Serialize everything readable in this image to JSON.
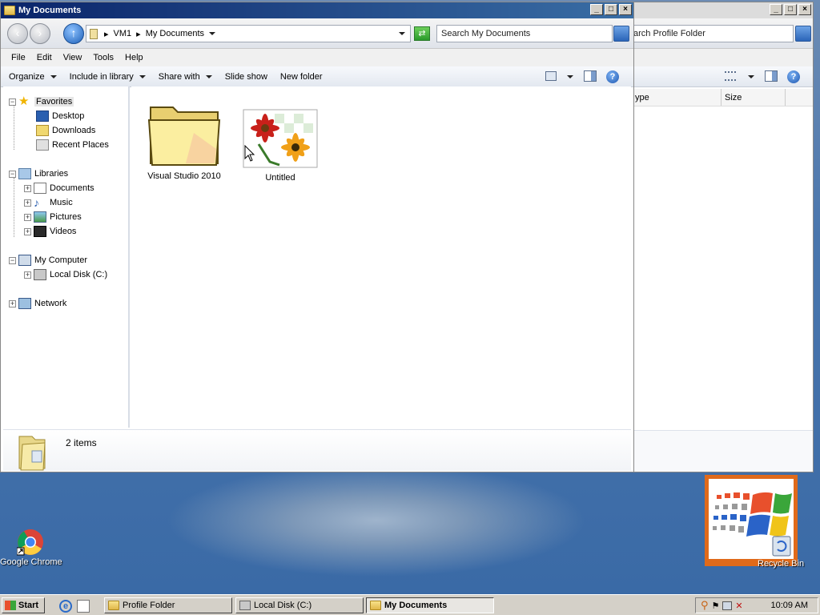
{
  "desktop": {
    "icons": [
      {
        "label": "Google Chrome"
      },
      {
        "label": "Recycle Bin"
      }
    ]
  },
  "bg_window": {
    "search_placeholder": "arch Profile Folder",
    "columns": [
      "ype",
      "Size"
    ]
  },
  "main_window": {
    "title": "My Documents",
    "breadcrumb": [
      "VM1",
      "My Documents"
    ],
    "search_placeholder": "Search My Documents",
    "menu": [
      "File",
      "Edit",
      "View",
      "Tools",
      "Help"
    ],
    "commands": [
      "Organize",
      "Include in library",
      "Share with",
      "Slide show",
      "New folder"
    ],
    "nav": {
      "favorites": "Favorites",
      "desktop": "Desktop",
      "downloads": "Downloads",
      "recent": "Recent Places",
      "libraries": "Libraries",
      "documents": "Documents",
      "music": "Music",
      "pictures": "Pictures",
      "videos": "Videos",
      "computer": "My Computer",
      "local_disk": "Local Disk (C:)",
      "network": "Network"
    },
    "files": [
      {
        "name": "Visual Studio 2010",
        "type": "folder"
      },
      {
        "name": "Untitled",
        "type": "image"
      }
    ],
    "status": "2 items"
  },
  "taskbar": {
    "start": "Start",
    "tasks": [
      "Profile Folder",
      "Local Disk (C:)",
      "My Documents"
    ],
    "clock": "10:09 AM"
  },
  "colors": {
    "title_active": "#0a246a",
    "desktop": "#3b6ea5",
    "recycle_border": "#e06a1a"
  }
}
